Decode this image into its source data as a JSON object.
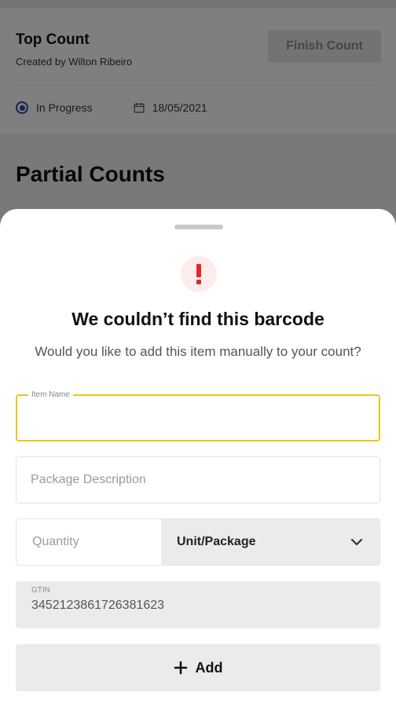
{
  "background": {
    "count": {
      "title": "Top Count",
      "created_by": "Created by Wilton Ribeiro",
      "finish_label": "Finish Count",
      "status": "In Progress",
      "date": "18/05/2021"
    },
    "section_title": "Partial Counts"
  },
  "sheet": {
    "alert_icon": "exclamation-icon",
    "title": "We couldn’t find this barcode",
    "subtitle": "Would you like to add this item manually to your count?",
    "item_name": {
      "label": "Item Name",
      "value": ""
    },
    "package_description": {
      "placeholder": "Package Description",
      "value": ""
    },
    "quantity": {
      "placeholder": "Quantity",
      "value": ""
    },
    "unit": {
      "selected": "Unit/Package"
    },
    "gtin": {
      "label": "GTIN",
      "value": "3452123861726381623"
    },
    "add_label": "Add"
  },
  "colors": {
    "focus_border": "#f0c419",
    "alert_red": "#e3262b",
    "status_blue": "#2a4d9c"
  }
}
